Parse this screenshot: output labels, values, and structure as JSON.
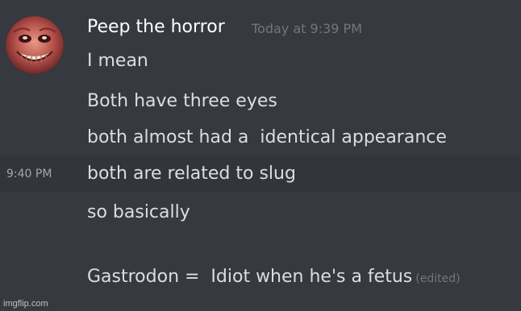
{
  "message": {
    "author": "Peep the horror",
    "timestamp": "Today at 9:39 PM",
    "avatar_icon": "grinning-face-avatar",
    "lines": [
      {
        "text": "I mean"
      },
      {
        "text": "Both have three eyes"
      },
      {
        "text": "both almost had a  identical appearance"
      },
      {
        "text": "both are related to slug",
        "hover_time": "9:40 PM"
      },
      {
        "text": "so basically"
      },
      {
        "text": "Gastrodon =  Idiot when he's a fetus",
        "edited": "(edited)"
      }
    ]
  },
  "watermark": "imgflip.com",
  "colors": {
    "background": "#36393f",
    "hover_row": "#32353b",
    "username": "#ffffff",
    "message_text": "#dcddde",
    "muted": "#72767d"
  }
}
